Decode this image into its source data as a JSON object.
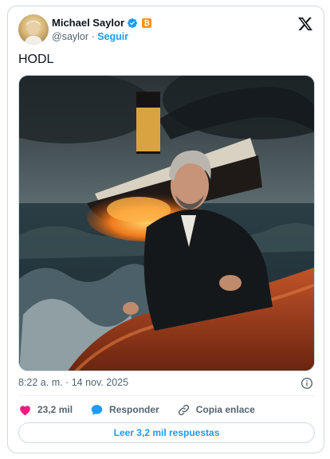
{
  "author": {
    "name": "Michael Saylor",
    "handle": "@saylor",
    "separator": "·",
    "follow_label": "Seguir",
    "btc_symbol": "₿"
  },
  "tweet": {
    "text": "HODL",
    "timestamp": "8:22 a. m. · 14 nov. 2025"
  },
  "actions": {
    "likes": "23,2 mil",
    "reply_label": "Responder",
    "copy_label": "Copia enlace"
  },
  "replies_button": "Leer 3,2 mil respuestas",
  "colors": {
    "accent": "#1d9bf0",
    "like": "#f91880",
    "btc": "#f7931a",
    "text": "#0f1419",
    "muted": "#536471"
  },
  "icons": {
    "verified": "verified-badge-icon",
    "platform": "x-logo-icon",
    "info": "info-icon",
    "like": "heart-icon",
    "reply": "speech-bubble-icon",
    "copy": "link-icon"
  }
}
